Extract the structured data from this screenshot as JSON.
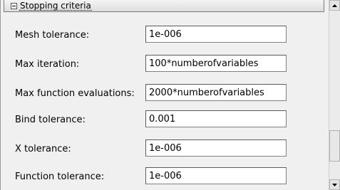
{
  "section": {
    "title": "Stopping criteria",
    "toggle_icon": "collapse-minus-icon"
  },
  "fields": [
    {
      "label": "Mesh tolerance:",
      "value": "1e-006"
    },
    {
      "label": "Max iteration:",
      "value": "100*numberofvariables"
    },
    {
      "label": "Max function evaluations:",
      "value": "2000*numberofvariables"
    },
    {
      "label": "Bind tolerance:",
      "value": "0.001"
    },
    {
      "label": "X tolerance:",
      "value": "1e-006"
    },
    {
      "label": "Function tolerance:",
      "value": "1e-006"
    }
  ],
  "scrollbar": {
    "up_icon": "arrow-up-icon",
    "down_icon": "arrow-down-icon"
  }
}
